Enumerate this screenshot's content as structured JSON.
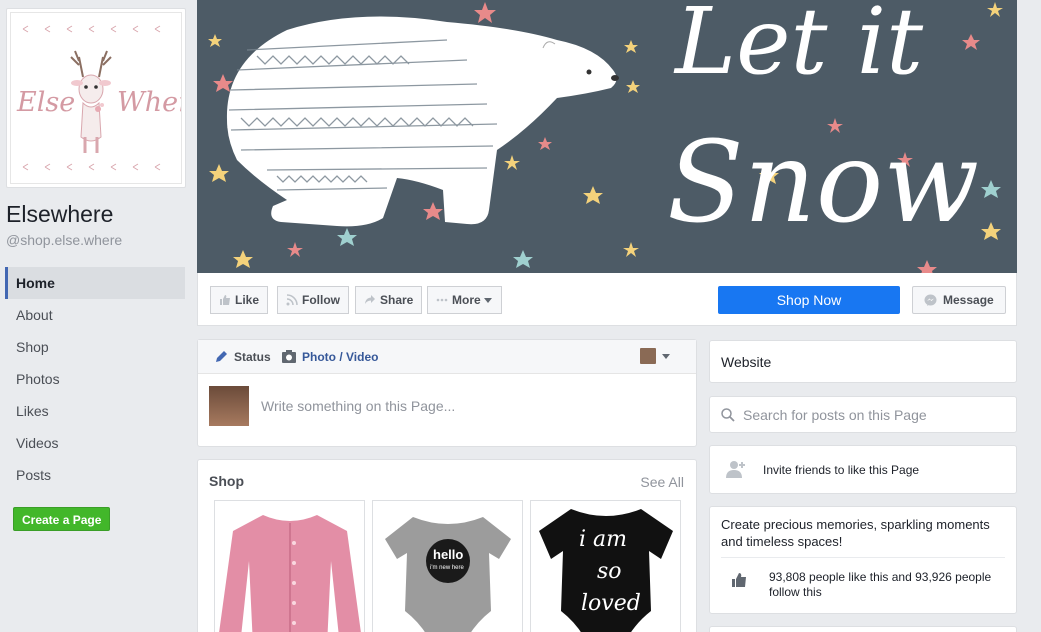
{
  "page": {
    "name": "Elsewhere",
    "handle": "@shop.else.where",
    "logo_left": "Else",
    "logo_right": "Where"
  },
  "nav": {
    "items": [
      {
        "label": "Home",
        "active": true
      },
      {
        "label": "About"
      },
      {
        "label": "Shop"
      },
      {
        "label": "Photos"
      },
      {
        "label": "Likes"
      },
      {
        "label": "Videos"
      },
      {
        "label": "Posts"
      }
    ],
    "create_page": "Create a Page"
  },
  "cover": {
    "line1": "Let it",
    "line2": "Snow",
    "bg_color": "#4d5b66"
  },
  "actions": {
    "like": "Like",
    "follow": "Follow",
    "share": "Share",
    "more": "More",
    "shop_now": "Shop Now",
    "message": "Message"
  },
  "composer": {
    "status_tab": "Status",
    "photo_tab": "Photo / Video",
    "placeholder": "Write something on this Page..."
  },
  "shop": {
    "title": "Shop",
    "see_all": "See All",
    "products": [
      {
        "name": "pink cardigan"
      },
      {
        "name": "grey romper",
        "print_line1": "hello",
        "print_line2": "i'm new here"
      },
      {
        "name": "black romper",
        "print_line1": "i am",
        "print_line2": "so",
        "print_line3": "loved"
      }
    ]
  },
  "sidebar_right": {
    "website": "Website",
    "search_placeholder": "Search for posts on this Page",
    "invite": "Invite friends to like this Page",
    "about": "Create precious memories, sparkling moments and timeless spaces!",
    "likes": "93,808 people like this and 93,926 people follow this"
  },
  "colors": {
    "accent": "#1877f2",
    "create_green": "#42b72a",
    "link_blue": "#365899",
    "logo_pink": "#d49aa3"
  }
}
